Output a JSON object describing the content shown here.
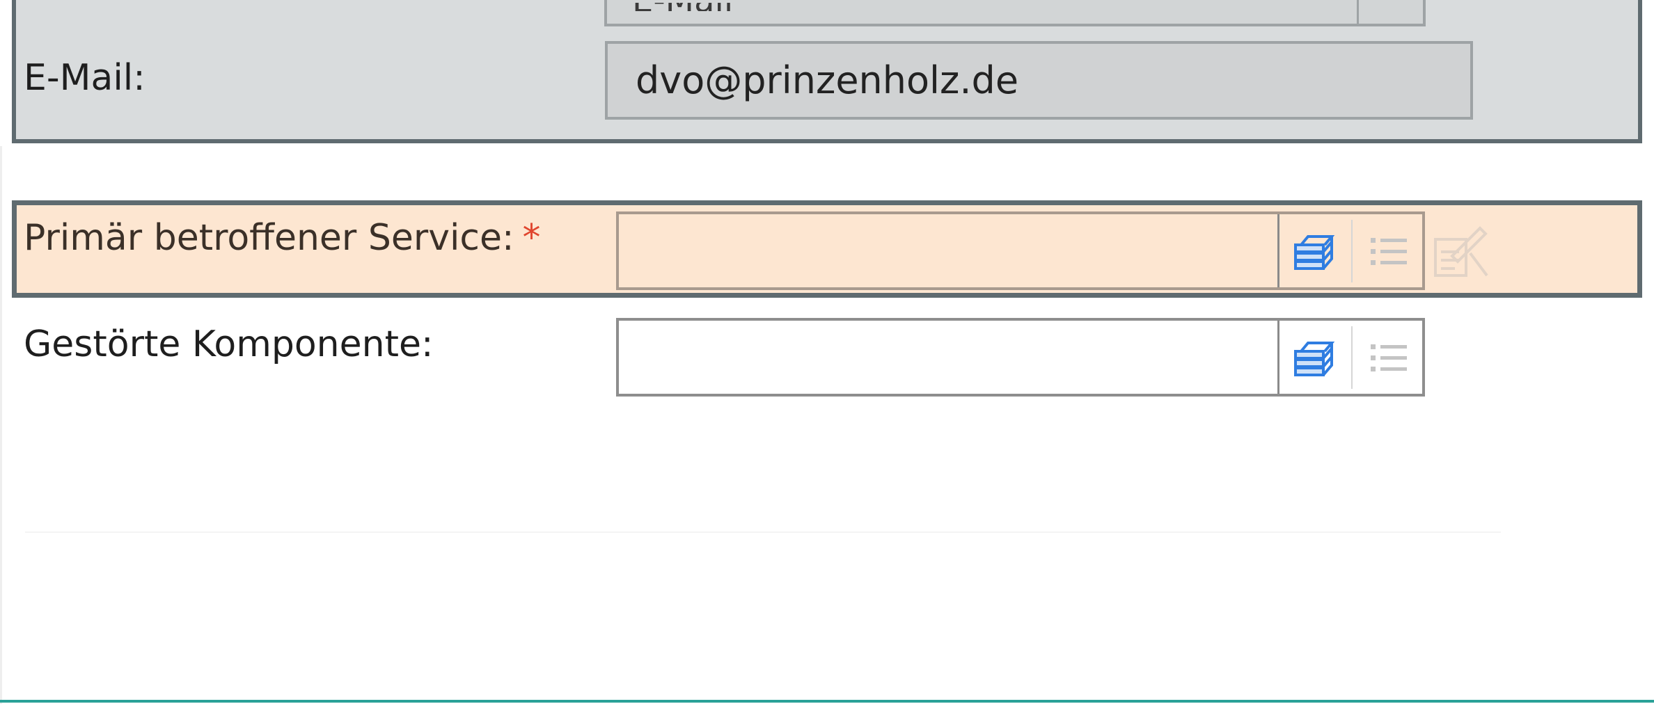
{
  "contact": {
    "cut_field_value": "E-Mail",
    "email_label": "E-Mail:",
    "email_value": "dvo@prinzenholz.de"
  },
  "service": {
    "label": "Primär betroffener Service:",
    "required_marker": "*",
    "value": "",
    "highlight_color": "#fde6d1"
  },
  "component": {
    "label": "Gestörte Komponente:",
    "value": ""
  },
  "icons": {
    "lookup": "database-lookup-icon",
    "list": "list-icon",
    "edit_disabled": "edit-disabled-icon"
  },
  "colors": {
    "icon_blue": "#2f7de1",
    "section_border": "#5f6b70",
    "required": "#e0452e",
    "accent_teal": "#2aa198"
  }
}
